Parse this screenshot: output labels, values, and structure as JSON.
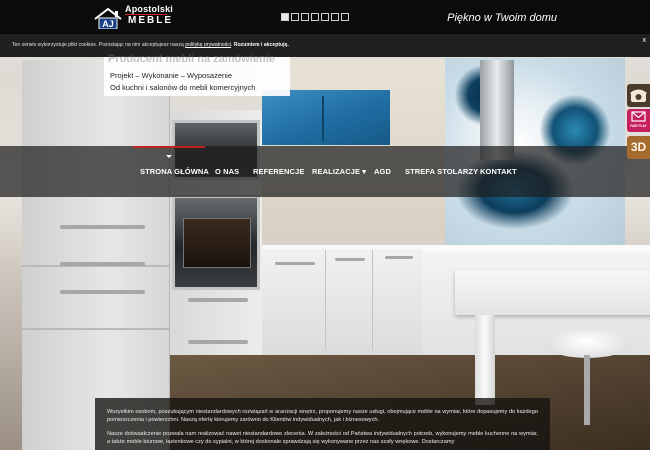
{
  "header": {
    "brand_top": "Apostolski",
    "brand_bottom": "MEBLE",
    "tagline": "Piękno w Twoim domu",
    "slides": {
      "count": 7,
      "active_index": 0
    }
  },
  "cookie_notice": {
    "text_before_link": "Ten serwis wykorzystuje pliki cookies. Pozostając na nim akceptujesz naszą ",
    "link_text": "politykę prywatności",
    "text_after_link": ". ",
    "accept_label": "Rozumiem i akceptuję.",
    "close_label": "x"
  },
  "hero": {
    "heading": "Producent mebli na zamówienie",
    "line1": "Projekt – Wykonanie – Wyposażenie",
    "line2": "Od kuchni i salonów do mebli komercyjnych"
  },
  "nav": {
    "items": [
      {
        "label": "STRONA GŁÓWNA"
      },
      {
        "label": "O NAS"
      },
      {
        "label": "REFERENCJE"
      },
      {
        "label": "REALIZACJE ▾"
      },
      {
        "label": "AGD"
      },
      {
        "label": "STREFA STOLARZY"
      },
      {
        "label": "KONTAKT"
      }
    ],
    "active": "STRONA GŁÓWNA",
    "accent_color": "#c0201f"
  },
  "side_badges": {
    "phone_icon": "phone-icon",
    "fair_label": "FAIR PLAY",
    "threed_label": "3D"
  },
  "about": {
    "p1": "Wszystkim osobom, poszukującym niestandardowych rozwiązań w aranżacji wnętrz, proponujemy nasze usługi, obejmujące meble na wymiar, które dopasujemy do każdego pomieszczenia i powierzchni. Naszą ofertę kierujemy zarówno do Klientów indywidualnych, jak i biznesowych.",
    "p2": "Nasze doświadczenie pozwala nam realizować nawet niestandardowe zlecenia. W zależności od Państwa indywidualnych potrzeb, wykonujemy meble kuchenne na wymiar, a także meble biurowe, łazienkowe czy do sypialni, w której doskonale sprawdzają się wykonywane przez nas szafy wnękowe. Dostarczamy"
  }
}
